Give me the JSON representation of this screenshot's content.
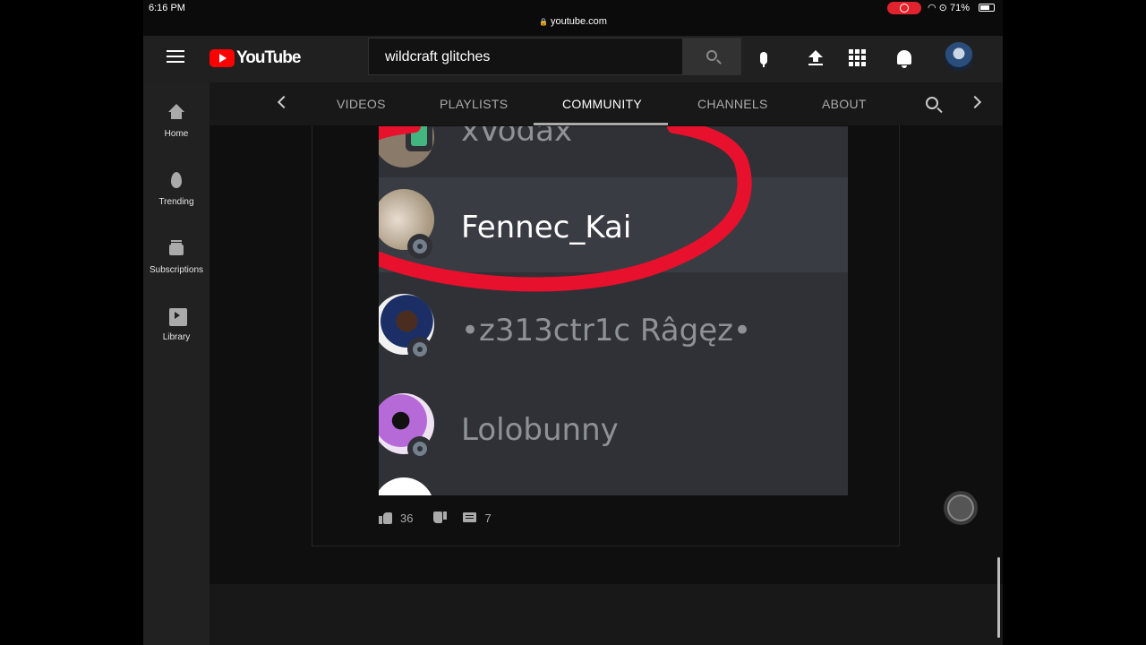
{
  "status_bar": {
    "time": "6:16 PM",
    "url": "youtube.com",
    "battery": "71%",
    "battery_level": 0.71
  },
  "header": {
    "logo_text": "YouTube",
    "search_value": "wildcraft glitches",
    "icons": [
      "menu-icon",
      "search-icon",
      "mic-icon",
      "upload-icon",
      "apps-icon",
      "bell-icon"
    ]
  },
  "sidebar": {
    "items": [
      {
        "label": "Home",
        "icon": "home-icon"
      },
      {
        "label": "Trending",
        "icon": "trending-icon"
      },
      {
        "label": "Subscriptions",
        "icon": "subscriptions-icon"
      },
      {
        "label": "Library",
        "icon": "library-icon"
      }
    ]
  },
  "channel_tabs": {
    "items": [
      {
        "label": "VIDEOS"
      },
      {
        "label": "PLAYLISTS"
      },
      {
        "label": "COMMUNITY",
        "active": true
      },
      {
        "label": "CHANNELS"
      },
      {
        "label": "ABOUT"
      }
    ]
  },
  "post": {
    "image_members": [
      "xVodax",
      "Fennec_Kai",
      "•z313ctr1c Râgęz•",
      "Lolobunny"
    ],
    "likes": "36",
    "comments": "7"
  },
  "colors": {
    "accent_red": "#e8112d",
    "online_green": "#43b581",
    "discord_bg": "#2f3136"
  }
}
